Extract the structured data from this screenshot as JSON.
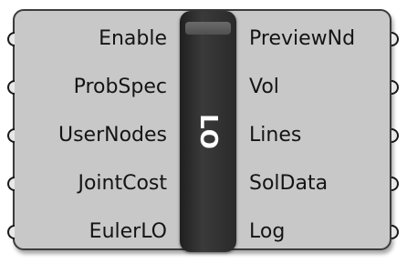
{
  "component": {
    "nickname": "LO",
    "inputs": [
      {
        "label": "Enable"
      },
      {
        "label": "ProbSpec"
      },
      {
        "label": "UserNodes"
      },
      {
        "label": "JointCost"
      },
      {
        "label": "EulerLO"
      }
    ],
    "outputs": [
      {
        "label": "PreviewNd"
      },
      {
        "label": "Vol"
      },
      {
        "label": "Lines"
      },
      {
        "label": "SolData"
      },
      {
        "label": "Log"
      }
    ]
  },
  "colors": {
    "body": "#c8c8c8",
    "border": "#3c3c3c",
    "center_bar": "#2a2a2a",
    "text": "#141414",
    "nickname_text": "#ffffff"
  }
}
